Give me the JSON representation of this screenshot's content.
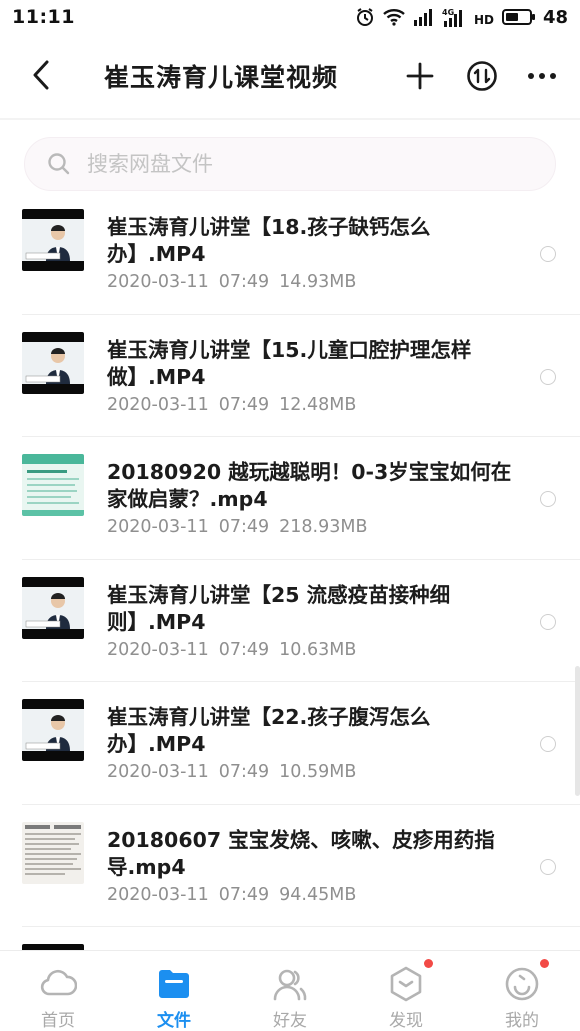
{
  "status_bar": {
    "time": "11:11",
    "battery": "48",
    "network_label": "4G",
    "hd_label": "HD"
  },
  "header": {
    "title": "崔玉涛育儿课堂视频"
  },
  "search": {
    "placeholder": "搜索网盘文件"
  },
  "files": [
    {
      "name": "崔玉涛育儿讲堂【18.孩子缺钙怎么办】.MP4",
      "date": "2020-03-11",
      "time": "07:49",
      "size": "14.93MB",
      "thumb": "lecture"
    },
    {
      "name": "崔玉涛育儿讲堂【15.儿童口腔护理怎样做】.MP4",
      "date": "2020-03-11",
      "time": "07:49",
      "size": "12.48MB",
      "thumb": "lecture"
    },
    {
      "name": "20180920 越玩越聪明！0-3岁宝宝如何在家做启蒙？.mp4",
      "date": "2020-03-11",
      "time": "07:49",
      "size": "218.93MB",
      "thumb": "green-slide"
    },
    {
      "name": "崔玉涛育儿讲堂【25 流感疫苗接种细则】.MP4",
      "date": "2020-03-11",
      "time": "07:49",
      "size": "10.63MB",
      "thumb": "lecture"
    },
    {
      "name": "崔玉涛育儿讲堂【22.孩子腹泻怎么办】.MP4",
      "date": "2020-03-11",
      "time": "07:49",
      "size": "10.59MB",
      "thumb": "lecture"
    },
    {
      "name": "20180607 宝宝发烧、咳嗽、皮疹用药指导.mp4",
      "date": "2020-03-11",
      "time": "07:49",
      "size": "94.45MB",
      "thumb": "document"
    }
  ],
  "bottom_nav": [
    {
      "label": "首页",
      "icon": "cloud-icon",
      "active": false,
      "badge": false
    },
    {
      "label": "文件",
      "icon": "folder-icon",
      "active": true,
      "badge": false
    },
    {
      "label": "好友",
      "icon": "friends-icon",
      "active": false,
      "badge": false
    },
    {
      "label": "发现",
      "icon": "discover-icon",
      "active": false,
      "badge": true
    },
    {
      "label": "我的",
      "icon": "profile-icon",
      "active": false,
      "badge": true
    }
  ],
  "colors": {
    "accent": "#1c8ff0",
    "badge": "#f24a46",
    "meta_text": "#8f8f8f"
  }
}
